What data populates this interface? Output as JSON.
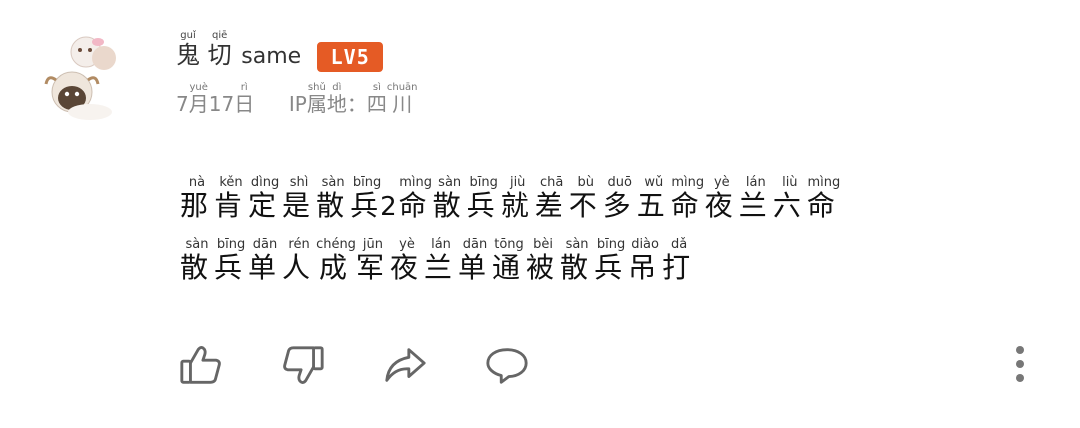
{
  "user": {
    "name_chars": [
      {
        "c": "鬼",
        "py": "guǐ"
      },
      {
        "c": "切",
        "py": "qiē"
      }
    ],
    "name_latin": "same",
    "level": "LV5",
    "level_color": "#e55b25"
  },
  "meta": {
    "date": [
      {
        "c": "7",
        "py": ""
      },
      {
        "c": "月",
        "py": "yuè"
      },
      {
        "c": "17",
        "py": ""
      },
      {
        "c": "日",
        "py": "rì"
      }
    ],
    "ip": [
      {
        "c": "IP",
        "py": ""
      },
      {
        "c": "属",
        "py": "shǔ"
      },
      {
        "c": "地",
        "py": "dì"
      },
      {
        "c": "：",
        "py": ""
      },
      {
        "c": "四",
        "py": "sì"
      },
      {
        "c": "川",
        "py": "chuān"
      }
    ]
  },
  "comment": {
    "line1": [
      {
        "c": "那",
        "py": "nà"
      },
      {
        "c": "肯",
        "py": "kěn"
      },
      {
        "c": "定",
        "py": "dìng"
      },
      {
        "c": "是",
        "py": "shì"
      },
      {
        "c": "散",
        "py": "sàn"
      },
      {
        "c": "兵",
        "py": "bīng"
      },
      {
        "c": "2",
        "py": ""
      },
      {
        "c": "命",
        "py": "mìng"
      },
      {
        "c": "散",
        "py": "sàn"
      },
      {
        "c": "兵",
        "py": "bīng"
      },
      {
        "c": "就",
        "py": "jiù"
      },
      {
        "c": "差",
        "py": "chā"
      },
      {
        "c": "不",
        "py": "bù"
      },
      {
        "c": "多",
        "py": "duō"
      },
      {
        "c": "五",
        "py": "wǔ"
      },
      {
        "c": "命",
        "py": "mìng"
      },
      {
        "c": "夜",
        "py": "yè"
      },
      {
        "c": "兰",
        "py": "lán"
      },
      {
        "c": "六",
        "py": "liù"
      },
      {
        "c": "命",
        "py": "mìng"
      }
    ],
    "line2": [
      {
        "c": "散",
        "py": "sàn"
      },
      {
        "c": "兵",
        "py": "bīng"
      },
      {
        "c": "单",
        "py": "dān"
      },
      {
        "c": "人",
        "py": "rén"
      },
      {
        "c": "成",
        "py": "chéng"
      },
      {
        "c": "军",
        "py": "jūn"
      },
      {
        "c": "夜",
        "py": "yè"
      },
      {
        "c": "兰",
        "py": "lán"
      },
      {
        "c": "单",
        "py": "dān"
      },
      {
        "c": "通",
        "py": "tōng"
      },
      {
        "c": "被",
        "py": "bèi"
      },
      {
        "c": "散",
        "py": "sàn"
      },
      {
        "c": "兵",
        "py": "bīng"
      },
      {
        "c": "吊",
        "py": "diào"
      },
      {
        "c": "打",
        "py": "dǎ"
      }
    ]
  },
  "actions": [
    {
      "name": "like-icon"
    },
    {
      "name": "dislike-icon"
    },
    {
      "name": "share-icon"
    },
    {
      "name": "comment-icon"
    }
  ],
  "colors": {
    "icon_stroke": "#666666",
    "meta_text": "#888888"
  }
}
